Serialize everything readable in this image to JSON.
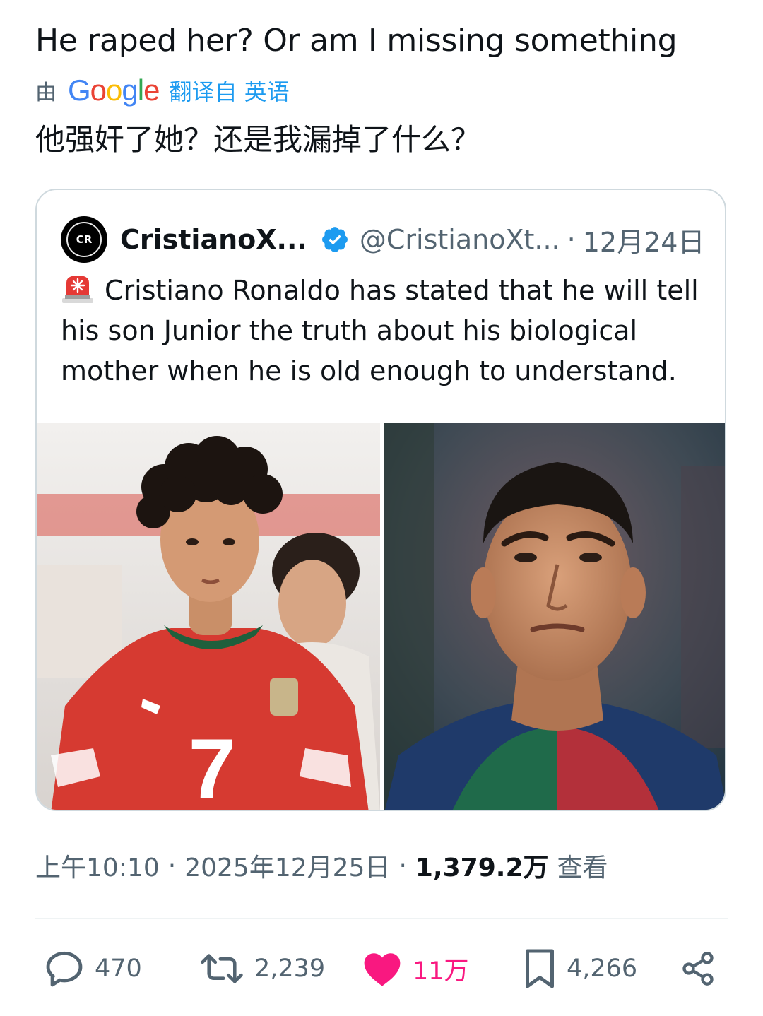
{
  "tweet": {
    "text": "He raped her? Or am I missing something",
    "translation": {
      "by": "由",
      "provider": "Google",
      "note": "翻译自 英语",
      "translated_text": "他强奸了她？还是我漏掉了什么？"
    },
    "quote": {
      "avatar_text": "CR",
      "name": "CristianoX...",
      "handle": "@CristianoXt...",
      "separator": "·",
      "date": "12月24日",
      "body": "Cristiano Ronaldo has stated that he will tell his son Junior the truth about his biological mother when he is old enough to understand.",
      "verified_color": "#1d9bf0",
      "player_number": "7"
    },
    "meta": {
      "time": "上午10:10",
      "sep1": "·",
      "date": "2025年12月25日",
      "sep2": "·",
      "views": "1,379.2万",
      "views_label": "查看"
    },
    "actions": {
      "replies": "470",
      "reposts": "2,239",
      "likes": "11万",
      "bookmarks": "4,266",
      "like_color": "#f91880"
    }
  }
}
